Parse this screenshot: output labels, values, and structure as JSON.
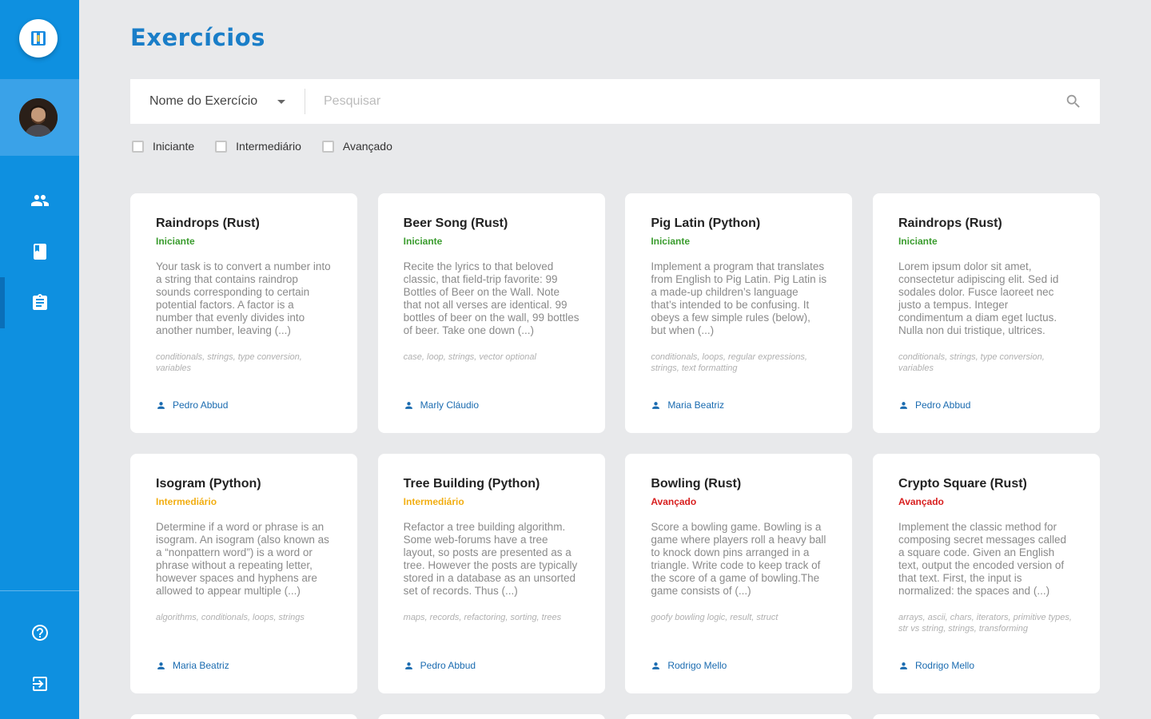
{
  "page": {
    "title": "Exercícios"
  },
  "sidebar": {
    "nav": [
      {
        "icon": "people-icon"
      },
      {
        "icon": "book-icon"
      },
      {
        "icon": "clipboard-icon",
        "active": true
      }
    ],
    "footer": [
      {
        "icon": "help-icon"
      },
      {
        "icon": "exit-icon"
      }
    ]
  },
  "search": {
    "filter_label": "Nome do Exercício",
    "placeholder": "Pesquisar"
  },
  "filters": {
    "beginner": "Iniciante",
    "intermediate": "Intermediário",
    "advanced": "Avançado"
  },
  "colors": {
    "sidebar": "#0e90e0",
    "accent": "#1a7ec8",
    "beginner": "#3a9c2e",
    "intermediate": "#f2ae12",
    "advanced": "#d82020"
  },
  "cards": [
    {
      "title": "Raindrops (Rust)",
      "level": "Iniciante",
      "desc": "Your task is to convert a number into a string that contains raindrop sounds corresponding to certain potential factors. A factor is a number that evenly divides into another number, leaving (...)",
      "tags": "conditionals, strings, type conversion, variables",
      "author": "Pedro Abbud"
    },
    {
      "title": "Beer Song (Rust)",
      "level": "Iniciante",
      "desc": "Recite the lyrics to that beloved classic, that field-trip favorite: 99 Bottles of Beer on the Wall. Note that not all verses are identical. 99 bottles of beer on the wall, 99 bottles of beer. Take one down (...)",
      "tags": "case, loop, strings, vector optional",
      "author": "Marly Cláudio"
    },
    {
      "title": "Pig Latin (Python)",
      "level": "Iniciante",
      "desc": "Implement a program that translates from English to Pig Latin. Pig Latin is a made-up children’s language that’s intended to be confusing. It obeys a few simple rules (below), but when (...)",
      "tags": "conditionals, loops, regular expressions, strings, text formatting",
      "author": "Maria Beatriz"
    },
    {
      "title": "Raindrops (Rust)",
      "level": "Iniciante",
      "desc": "Lorem ipsum dolor sit amet, consectetur adipiscing elit. Sed id sodales dolor. Fusce laoreet nec justo a tempus. Integer condimentum a diam eget luctus. Nulla non dui tristique, ultrices.",
      "tags": "conditionals, strings, type conversion, variables",
      "author": "Pedro Abbud"
    },
    {
      "title": "Isogram (Python)",
      "level": "Intermediário",
      "desc": "Determine if a word or phrase is an isogram. An isogram (also known as a “nonpattern word”) is a word or phrase without a repeating letter, however spaces and hyphens are allowed to appear multiple (...)",
      "tags": "algorithms, conditionals, loops, strings",
      "author": "Maria Beatriz"
    },
    {
      "title": "Tree Building (Python)",
      "level": "Intermediário",
      "desc": "Refactor a tree building algorithm. Some web-forums have a tree layout, so posts are presented as a tree. However the posts are typically stored in a database as an unsorted set of records. Thus (...)",
      "tags": "maps, records, refactoring, sorting, trees",
      "author": "Pedro Abbud"
    },
    {
      "title": "Bowling (Rust)",
      "level": "Avançado",
      "desc": "Score a bowling game. Bowling is a game where players roll a heavy ball to knock down pins arranged in a triangle. Write code to keep track of the score of a game of bowling.The game consists of (...)",
      "tags": "goofy bowling logic, result, struct",
      "author": "Rodrigo Mello"
    },
    {
      "title": "Crypto Square (Rust)",
      "level": "Avançado",
      "desc": "Implement the classic method for composing secret messages called a square code. Given an English text, output the encoded version of that text. First, the input is normalized: the spaces and (...)",
      "tags": "arrays, ascii, chars, iterators, primitive types, str vs string, strings, transforming",
      "author": "Rodrigo Mello"
    }
  ]
}
